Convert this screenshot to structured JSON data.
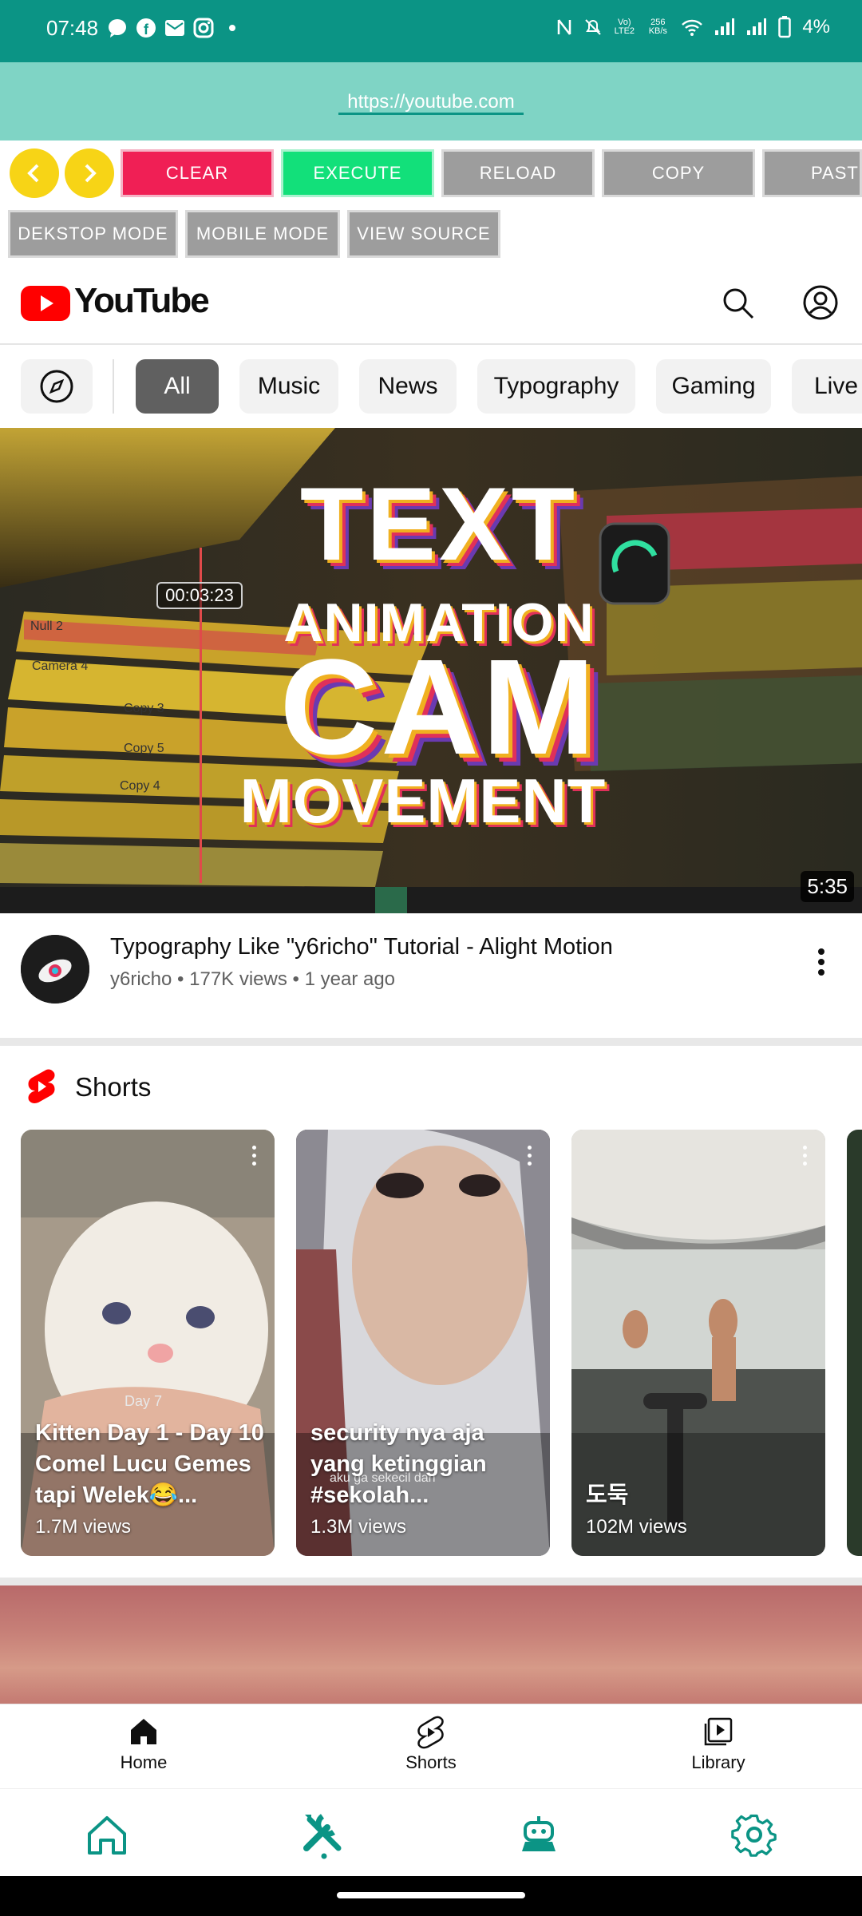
{
  "status_bar": {
    "time": "07:48",
    "battery": "4%",
    "network_small": "Vo) LTE2",
    "speed": "256 KB/s"
  },
  "browser": {
    "url": "https://youtube.com",
    "back_icon": "chevron-left-icon",
    "forward_icon": "chevron-right-icon",
    "buttons": {
      "clear": "CLEAR",
      "execute": "EXECUTE",
      "reload": "RELOAD",
      "copy": "COPY",
      "paste": "PASTE",
      "desktop_mode": "DEKSTOP MODE",
      "mobile_mode": "MOBILE MODE",
      "view_source": "VIEW SOURCE"
    },
    "colors": {
      "clear": "#f01f55",
      "execute": "#12e07a",
      "gray": "#9d9d9d",
      "accent": "#0b9485",
      "nav_yellow": "#f7d416"
    }
  },
  "youtube": {
    "logo_text": "YouTube",
    "chips": [
      "All",
      "Music",
      "News",
      "Typography",
      "Gaming",
      "Live"
    ],
    "video": {
      "thumbnail_lines": [
        "TEXT",
        "ANIMATION",
        "CAM",
        "MOVEMENT"
      ],
      "timecode": "00:03:23",
      "duration": "5:35",
      "title": "Typography Like \"y6richo\" Tutorial - Alight Motion",
      "channel": "y6richo",
      "views": "177K views",
      "age": "1 year ago",
      "track_labels": [
        "Null 2",
        "Camera 4",
        "Copy 3",
        "Copy 5",
        "Copy 4"
      ]
    },
    "shorts_header": "Shorts",
    "shorts": [
      {
        "title": "Kitten Day 1 - Day 10 Comel Lucu Gemes tapi Welek😂...",
        "views": "1.7M views",
        "overlay": "Day 7"
      },
      {
        "title": "security nya aja yang ketinggian #sekolah...",
        "views": "1.3M views",
        "overlay": "aku ga sekecil dan"
      },
      {
        "title": "도둑",
        "views": "102M views",
        "overlay": ""
      }
    ],
    "bottom_nav": [
      "Home",
      "Shorts",
      "Library"
    ]
  },
  "app_nav": [
    "home-icon",
    "tools-icon",
    "robot-icon",
    "settings-icon"
  ]
}
